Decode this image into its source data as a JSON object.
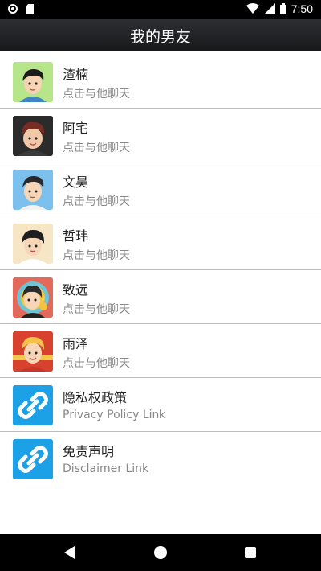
{
  "status_bar": {
    "time": "7:50"
  },
  "app_bar": {
    "title": "我的男友"
  },
  "list": [
    {
      "name": "渣楠",
      "subtitle": "点击与他聊天",
      "avatar_icon": "boy-avatar-icon",
      "bg": "#b6e58a"
    },
    {
      "name": "阿宅",
      "subtitle": "点击与他聊天",
      "avatar_icon": "boy-avatar-icon",
      "bg": "#2b2b2b"
    },
    {
      "name": "文昊",
      "subtitle": "点击与他聊天",
      "avatar_icon": "boy-avatar-icon",
      "bg": "#7cc0ee"
    },
    {
      "name": "哲玮",
      "subtitle": "点击与他聊天",
      "avatar_icon": "boy-avatar-icon",
      "bg": "#f6e6c6"
    },
    {
      "name": "致远",
      "subtitle": "点击与他聊天",
      "avatar_icon": "boy-avatar-icon",
      "bg": "#e36a5a"
    },
    {
      "name": "雨泽",
      "subtitle": "点击与他聊天",
      "avatar_icon": "boy-avatar-icon",
      "bg": "#d9412f"
    },
    {
      "name": "隐私权政策",
      "subtitle": "Privacy Policy Link",
      "avatar_icon": "link-icon",
      "bg": "#1da1e6"
    },
    {
      "name": "免责声明",
      "subtitle": "Disclaimer Link",
      "avatar_icon": "link-icon",
      "bg": "#1da1e6"
    }
  ]
}
